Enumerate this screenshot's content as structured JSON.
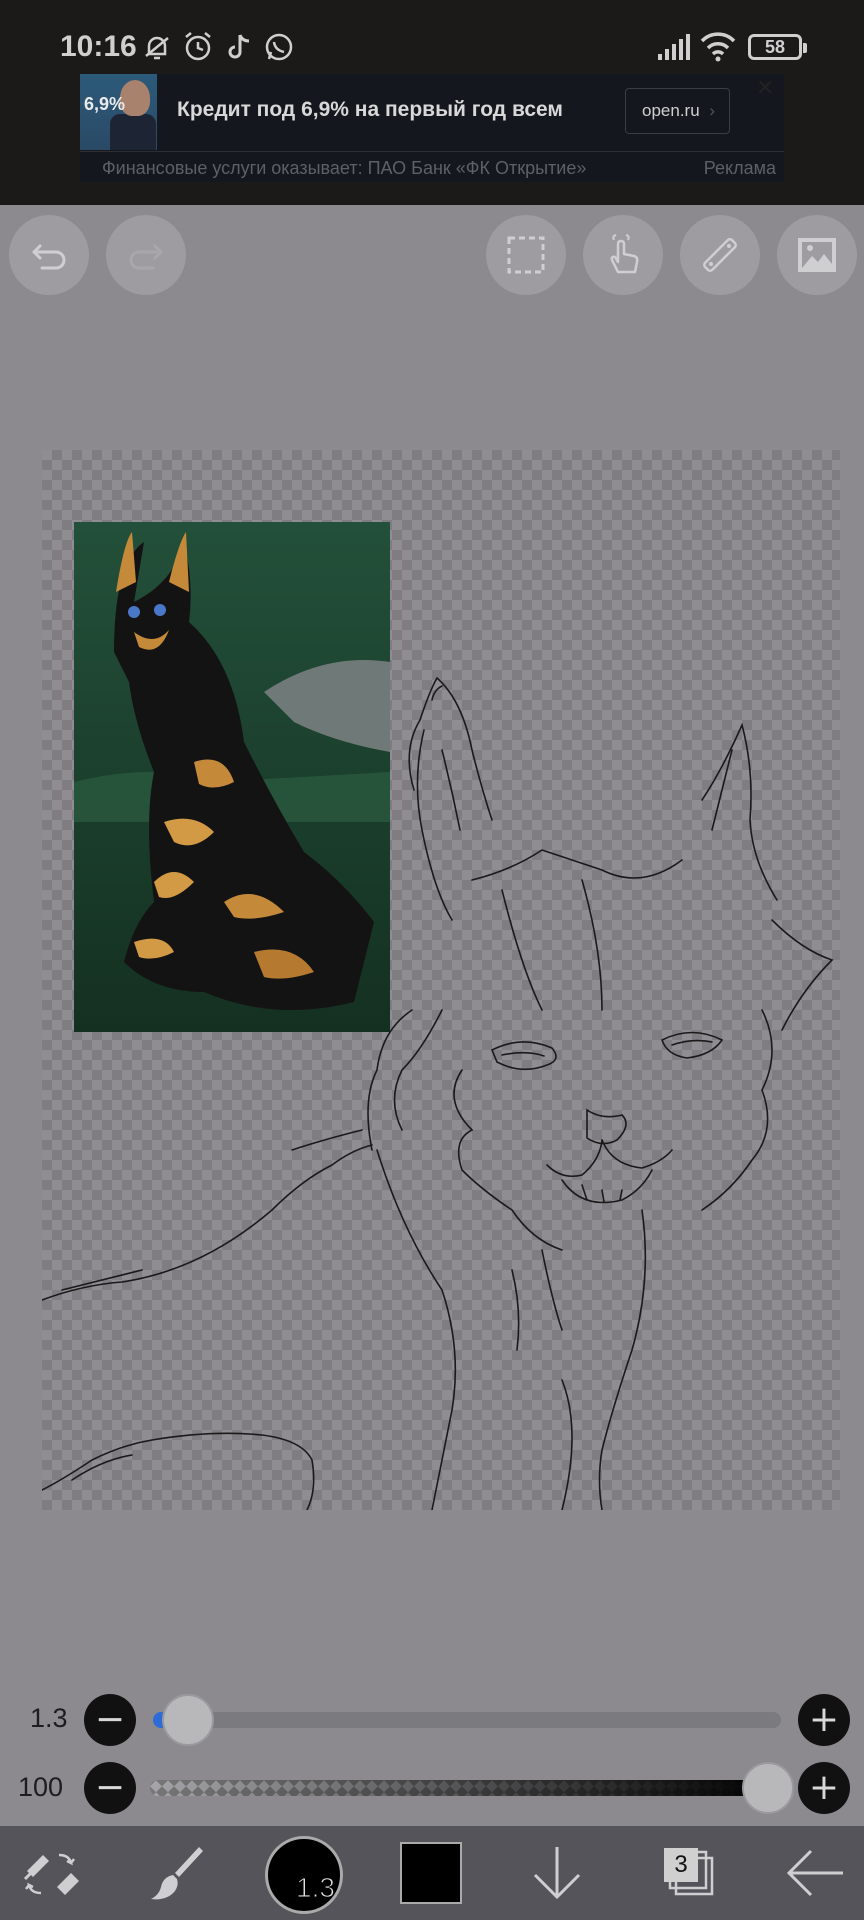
{
  "status_bar": {
    "time": "10:16",
    "battery": "58",
    "icons": [
      "mute-icon",
      "alarm-icon",
      "tiktok-icon",
      "whatsapp-icon",
      "signal-icon",
      "wifi-icon",
      "battery-icon"
    ]
  },
  "ad": {
    "thumb_text": "6,9%",
    "title": "Кредит под 6,9% на первый год всем",
    "button_label": "open.ru",
    "subtitle": "Финансовые услуги оказывает: ПАО Банк «ФК Открытие»",
    "label": "Реклама"
  },
  "toolbar": {
    "left": [
      "undo-icon",
      "redo-icon"
    ],
    "right": [
      "selection-icon",
      "hand-icon",
      "ruler-icon",
      "image-icon"
    ]
  },
  "brush_size_slider": {
    "value_label": "1.3",
    "minus": "−",
    "plus": "+",
    "level": 0.02
  },
  "opacity_slider": {
    "value_label": "100",
    "minus": "−",
    "plus": "+",
    "level": 1.0
  },
  "bottom_bar": {
    "brush_size": "1.3",
    "color": "#000000",
    "layer_count": "3",
    "icons": [
      "tool-swap-icon",
      "brush-icon",
      "brush-size-icon",
      "color-icon",
      "save-down-icon",
      "layers-icon",
      "back-icon"
    ]
  },
  "colors": {
    "accent": "#2e6bd6",
    "background": "#8c8a8f",
    "bottom_bar": "#55545a"
  }
}
